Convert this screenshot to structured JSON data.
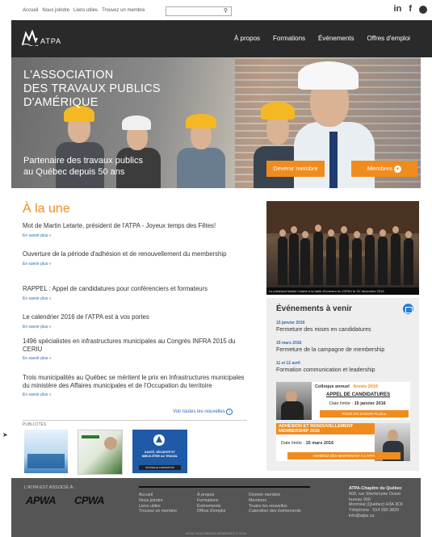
{
  "topbar": {
    "links": [
      "Accueil",
      "Nous joindre",
      "Liens utiles",
      "Trouvez un membre"
    ],
    "search_placeholder": "",
    "social": [
      "in",
      "f",
      "t"
    ]
  },
  "nav": {
    "logo_text": "ATPA",
    "items": [
      "À propos",
      "Formations",
      "Événements",
      "Offres d'emploi"
    ]
  },
  "hero": {
    "title_lines": [
      "L'ASSOCIATION",
      "DES TRAVAUX PUBLICS",
      "D'AMÉRIQUE"
    ],
    "tagline_lines": [
      "Partenaire des travaux publics",
      "au Québec depuis 50 ans"
    ],
    "btn_member": "Devenir membre",
    "btn_members": "Membres"
  },
  "main": {
    "title": "À la une",
    "more": "En savoir plus »",
    "news": [
      {
        "text": "Mot de Martin Letarte, président de l'ATPA - Joyeux temps des Fêtes!"
      },
      {
        "text": "Ouverture de la période d'adhésion et de renouvellement du membership"
      },
      {
        "text": "RAPPEL : Appel de candidatures pour conférenciers et formateurs"
      },
      {
        "text": "Le calendrier 2016 de l'ATPA est à vos portes"
      },
      {
        "text": "1496 spécialistes en infrastructures municipales au Congrès INFRA 2015 du CERIU"
      },
      {
        "text": "Trois municipalités au Québec se méritent le prix en Infrastructures municipales du ministère des Affaires municipales et de l'Occupation du territoire"
      }
    ],
    "all_news": "Voir toutes les nouvelles",
    "publications_label": "PUBLICITÉS",
    "pub_ad3": [
      "SANTÉ, SÉCURITÉ ET",
      "MIEUX-ÊTRE AU TRAVAIL",
      "NOUVELLE FORMATION!"
    ]
  },
  "sidebar": {
    "photo_caption": "Le président Martin Letarte à la table d'honneur du CERIU le XX décembre 2015",
    "events_title": "Événements à venir",
    "events": [
      {
        "date": "15 janvier 2016",
        "name": "Fermeture des mises en candidatures"
      },
      {
        "date": "15 mars 2016",
        "name": "Fermeture de la campagne de membership"
      },
      {
        "date": "11 et 12 avril",
        "name": "Formation communication et leadership"
      }
    ],
    "promo1": {
      "line1": "Colloque annuel",
      "year": "Année 2016",
      "line2": "APPEL DE CANDIDATURES",
      "deadline_label": "Date limite :",
      "deadline": "15 janvier 2016",
      "cta": "POUR EN SAVOIR PLUS"
    },
    "promo2": {
      "line1": "ADHÉSION ET RENOUVELLEMENT",
      "line2": "MEMBERSHIP 2016",
      "deadline_label": "Date limite :",
      "deadline": "15 mars 2016",
      "cta": "ADHÉREZ DÈS MAINTENANT À L'ATPA"
    }
  },
  "footer": {
    "assoc_label": "L'ATPA EST ASSOCIÉ À :",
    "partners": [
      "APWA",
      "CPWA"
    ],
    "col1": [
      "Accueil",
      "Nous joindre",
      "Liens utiles",
      "Trouvez un membre"
    ],
    "col2": [
      "À propos",
      "Formations",
      "Événements",
      "Offres d'emploi"
    ],
    "col3": [
      "Devenir membre",
      "Membres",
      "Toutes les nouvelles",
      "Calendrier des événements"
    ],
    "address": [
      "ATPA-Chapitre du Québec",
      "500, rue Sherbrooke Ouest",
      "bureau 900",
      "Montréal (Québec) H3A 3C6",
      "Téléphone : 514 282-3820",
      "info@atpa.ca"
    ],
    "copyright": "ATPA TOUS DROITS RÉSERVÉS © 2016"
  },
  "colors": {
    "accent": "#f08c1e",
    "link": "#2b6cb0",
    "nav": "#2a2a2a",
    "footer": "#555555"
  }
}
